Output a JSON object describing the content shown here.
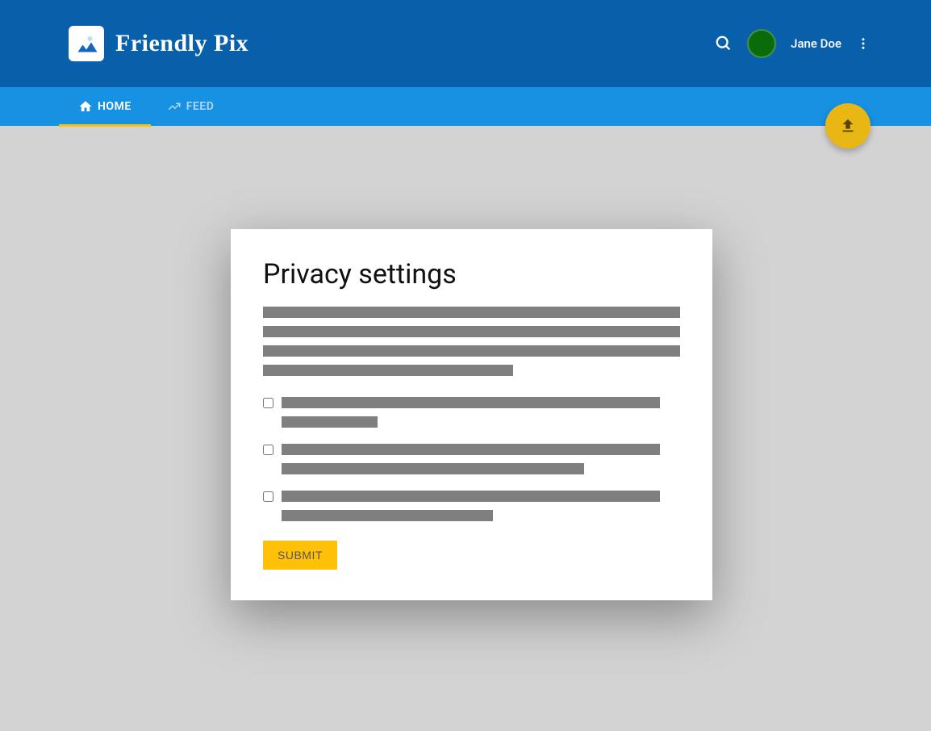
{
  "header": {
    "app_name": "Friendly Pix",
    "username": "Jane Doe"
  },
  "nav": {
    "tabs": [
      {
        "label": "HOME",
        "active": true
      },
      {
        "label": "FEED",
        "active": false
      }
    ]
  },
  "dialog": {
    "title": "Privacy settings",
    "submit_label": "SUBMIT",
    "checkboxes": [
      {
        "checked": false
      },
      {
        "checked": false
      },
      {
        "checked": false
      }
    ]
  }
}
